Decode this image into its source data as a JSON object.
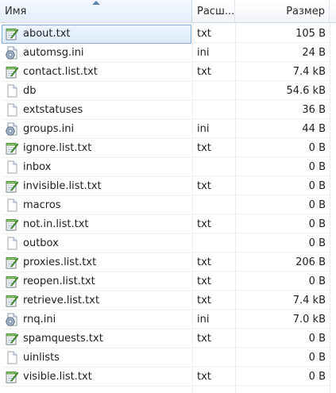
{
  "header": {
    "name": "Имя",
    "ext": "Расш...",
    "size": "Размер"
  },
  "files": [
    {
      "name": "about.txt",
      "ext": "txt",
      "size": "105 B",
      "icon": "notepad-icon",
      "selected": true
    },
    {
      "name": "automsg.ini",
      "ext": "ini",
      "size": "24 B",
      "icon": "settings-file-icon"
    },
    {
      "name": "contact.list.txt",
      "ext": "txt",
      "size": "7.4 kB",
      "icon": "notepad-icon"
    },
    {
      "name": "db",
      "ext": "",
      "size": "54.6 kB",
      "icon": "blank-file-icon"
    },
    {
      "name": "extstatuses",
      "ext": "",
      "size": "36 B",
      "icon": "blank-file-icon"
    },
    {
      "name": "groups.ini",
      "ext": "ini",
      "size": "44 B",
      "icon": "settings-file-icon"
    },
    {
      "name": "ignore.list.txt",
      "ext": "txt",
      "size": "0 B",
      "icon": "notepad-icon"
    },
    {
      "name": "inbox",
      "ext": "",
      "size": "0 B",
      "icon": "blank-file-icon"
    },
    {
      "name": "invisible.list.txt",
      "ext": "txt",
      "size": "0 B",
      "icon": "notepad-icon"
    },
    {
      "name": "macros",
      "ext": "",
      "size": "0 B",
      "icon": "blank-file-icon"
    },
    {
      "name": "not.in.list.txt",
      "ext": "txt",
      "size": "0 B",
      "icon": "notepad-icon"
    },
    {
      "name": "outbox",
      "ext": "",
      "size": "0 B",
      "icon": "blank-file-icon"
    },
    {
      "name": "proxies.list.txt",
      "ext": "txt",
      "size": "206 B",
      "icon": "notepad-icon"
    },
    {
      "name": "reopen.list.txt",
      "ext": "txt",
      "size": "0 B",
      "icon": "notepad-icon"
    },
    {
      "name": "retrieve.list.txt",
      "ext": "txt",
      "size": "7.4 kB",
      "icon": "notepad-icon"
    },
    {
      "name": "rnq.ini",
      "ext": "ini",
      "size": "7.0 kB",
      "icon": "settings-file-icon"
    },
    {
      "name": "spamquests.txt",
      "ext": "txt",
      "size": "0 B",
      "icon": "notepad-icon"
    },
    {
      "name": "uinlists",
      "ext": "",
      "size": "0 B",
      "icon": "blank-file-icon"
    },
    {
      "name": "visible.list.txt",
      "ext": "txt",
      "size": "0 B",
      "icon": "notepad-icon"
    }
  ]
}
